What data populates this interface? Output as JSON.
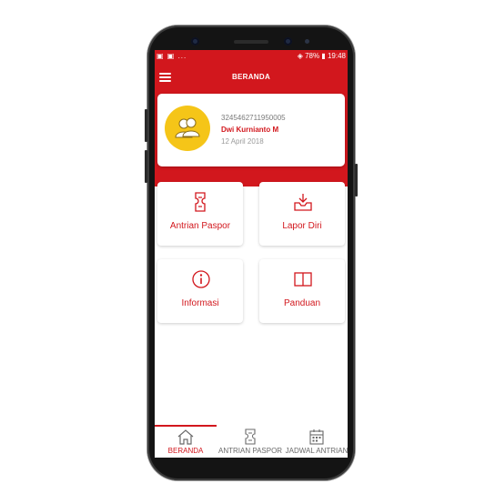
{
  "status_bar": {
    "left": "▣ ▣ ...",
    "right": "◈ 78% ▮ 19:48"
  },
  "app_bar": {
    "title": "BERANDA"
  },
  "profile": {
    "id": "3245462711950005",
    "name": "Dwi Kurnianto M",
    "date": "12 April 2018"
  },
  "menu": [
    {
      "label": "Antrian Paspor",
      "icon": "ticket-icon"
    },
    {
      "label": "Lapor Diri",
      "icon": "inbox-download-icon"
    },
    {
      "label": "Informasi",
      "icon": "info-icon"
    },
    {
      "label": "Panduan",
      "icon": "book-icon"
    }
  ],
  "tabs": [
    {
      "label": "BERANDA",
      "icon": "home-icon",
      "active": true
    },
    {
      "label": "ANTRIAN PASPOR",
      "icon": "ticket-icon",
      "active": false
    },
    {
      "label": "JADWAL ANTRIAN",
      "icon": "calendar-icon",
      "active": false
    }
  ],
  "colors": {
    "primary": "#d2171d",
    "avatar_bg": "#f5c518"
  }
}
